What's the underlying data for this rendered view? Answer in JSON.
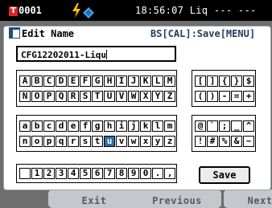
{
  "status_bar": {
    "device_icon": "T",
    "device_number": "0001",
    "status_text": "18:56:07 Liq --- ---",
    "icons": [
      "flash-icon",
      "sensor-icon"
    ]
  },
  "dialog": {
    "title": "Edit Name",
    "hint": "BS[CAL]:Save[MENU]",
    "input_value": "CFG12202011-Liqu",
    "save_label": "Save"
  },
  "keyboard": {
    "selected_key": "u",
    "upper_row1": [
      "A",
      "B",
      "C",
      "D",
      "E",
      "F",
      "G",
      "H",
      "I",
      "J",
      "K",
      "L",
      "M"
    ],
    "upper_row2": [
      "N",
      "O",
      "P",
      "Q",
      "R",
      "S",
      "T",
      "U",
      "V",
      "W",
      "X",
      "Y",
      "Z"
    ],
    "lower_row1": [
      "a",
      "b",
      "c",
      "d",
      "e",
      "f",
      "g",
      "h",
      "i",
      "j",
      "k",
      "l",
      "m"
    ],
    "lower_row2": [
      "n",
      "o",
      "p",
      "q",
      "r",
      "s",
      "t",
      "u",
      "v",
      "w",
      "x",
      "y",
      "z"
    ],
    "digit_row": [
      " ",
      "1",
      "2",
      "3",
      "4",
      "5",
      "6",
      "7",
      "8",
      "9",
      "0",
      ".",
      ","
    ],
    "symbols_row1": [
      "[",
      "]",
      "{",
      "}",
      "$"
    ],
    "symbols_row2": [
      "(",
      ")",
      "-",
      "=",
      "+"
    ],
    "symbols_row3": [
      "@",
      "`",
      ";",
      "_",
      "^"
    ],
    "symbols_row4": [
      "!",
      "#",
      "%",
      "&",
      "~"
    ]
  },
  "function_bar": {
    "buttons": [
      "Exit",
      "Previous",
      "Next"
    ]
  },
  "colors": {
    "device_icon": "#d9262b",
    "selected_key": "#2f6ea6",
    "hint_text": "#1f3d5c",
    "background_dim": "#6e6e6e"
  }
}
